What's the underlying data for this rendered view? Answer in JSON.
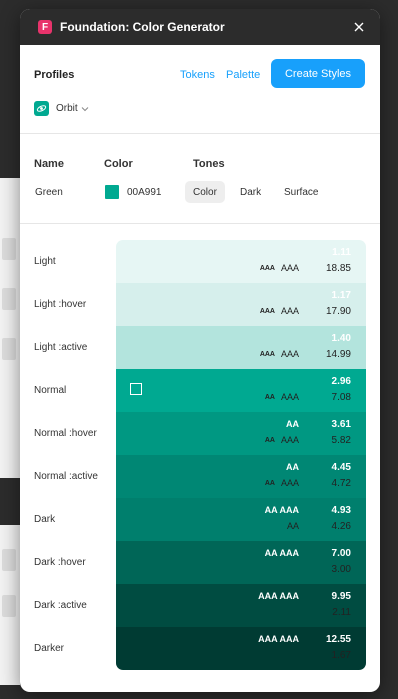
{
  "window": {
    "title": "Foundation: Color Generator",
    "logo_letter": "F"
  },
  "profiles": {
    "heading": "Profiles",
    "tokens_link": "Tokens",
    "palette_link": "Palette",
    "create_button": "Create Styles",
    "selected_profile": "Orbit"
  },
  "color_header": {
    "name_label": "Name",
    "color_label": "Color",
    "tones_label": "Tones",
    "name_value": "Green",
    "hex_value": "00A991",
    "tone_tabs": [
      "Color",
      "Dark",
      "Surface"
    ],
    "active_tab": "Color"
  },
  "colors": {
    "accent": "#18a0fb",
    "brand": "#00a991",
    "title_bar": "#2c2c2c"
  },
  "tones": [
    {
      "label": "Light",
      "bg": "#e6f6f4",
      "fg": "#222222",
      "top_ratio": "1.11",
      "top_badge": "",
      "bottom_badges": [
        "AAA",
        "AAA"
      ],
      "bottom_ratio": "18.85",
      "checkbox": false
    },
    {
      "label": "Light :hover",
      "bg": "#d6efec",
      "fg": "#222222",
      "top_ratio": "1.17",
      "top_badge": "",
      "bottom_badges": [
        "AAA",
        "AAA"
      ],
      "bottom_ratio": "17.90",
      "checkbox": false
    },
    {
      "label": "Light :active",
      "bg": "#b3e4dd",
      "fg": "#222222",
      "top_ratio": "1.40",
      "top_badge": "",
      "bottom_badges": [
        "AAA",
        "AAA"
      ],
      "bottom_ratio": "14.99",
      "checkbox": false
    },
    {
      "label": "Normal",
      "bg": "#00a991",
      "fg": "#222222",
      "top_ratio": "2.96",
      "top_badge": "",
      "bottom_badges": [
        "AA",
        "AAA"
      ],
      "bottom_ratio": "7.08",
      "checkbox": true
    },
    {
      "label": "Normal :hover",
      "bg": "#009882",
      "fg": "#222222",
      "top_ratio": "3.61",
      "top_badge": "AA",
      "bottom_badges": [
        "AA",
        "AAA"
      ],
      "bottom_ratio": "5.82",
      "checkbox": false
    },
    {
      "label": "Normal :active",
      "bg": "#008774",
      "fg": "#222222",
      "top_ratio": "4.45",
      "top_badge": "AA",
      "bottom_badges": [
        "AA",
        "AAA"
      ],
      "bottom_ratio": "4.72",
      "checkbox": false
    },
    {
      "label": "Dark",
      "bg": "#007f6d",
      "fg": "#222222",
      "top_ratio": "4.93",
      "top_badge": "AA  AAA",
      "bottom_badges": [
        "",
        "AA"
      ],
      "bottom_ratio": "4.26",
      "checkbox": false
    },
    {
      "label": "Dark :hover",
      "bg": "#006657",
      "fg": "#222222",
      "top_ratio": "7.00",
      "top_badge": "AA  AAA",
      "bottom_badges": [
        "",
        ""
      ],
      "bottom_ratio": "3.00",
      "checkbox": false
    },
    {
      "label": "Dark :active",
      "bg": "#004c41",
      "fg": "#222222",
      "top_ratio": "9.95",
      "top_badge": "AAA  AAA",
      "bottom_badges": [
        "",
        ""
      ],
      "bottom_ratio": "2.11",
      "checkbox": false
    },
    {
      "label": "Darker",
      "bg": "#003b33",
      "fg": "#222222",
      "top_ratio": "12.55",
      "top_badge": "AAA  AAA",
      "bottom_badges": [
        "",
        ""
      ],
      "bottom_ratio": "1.67",
      "checkbox": false
    }
  ]
}
